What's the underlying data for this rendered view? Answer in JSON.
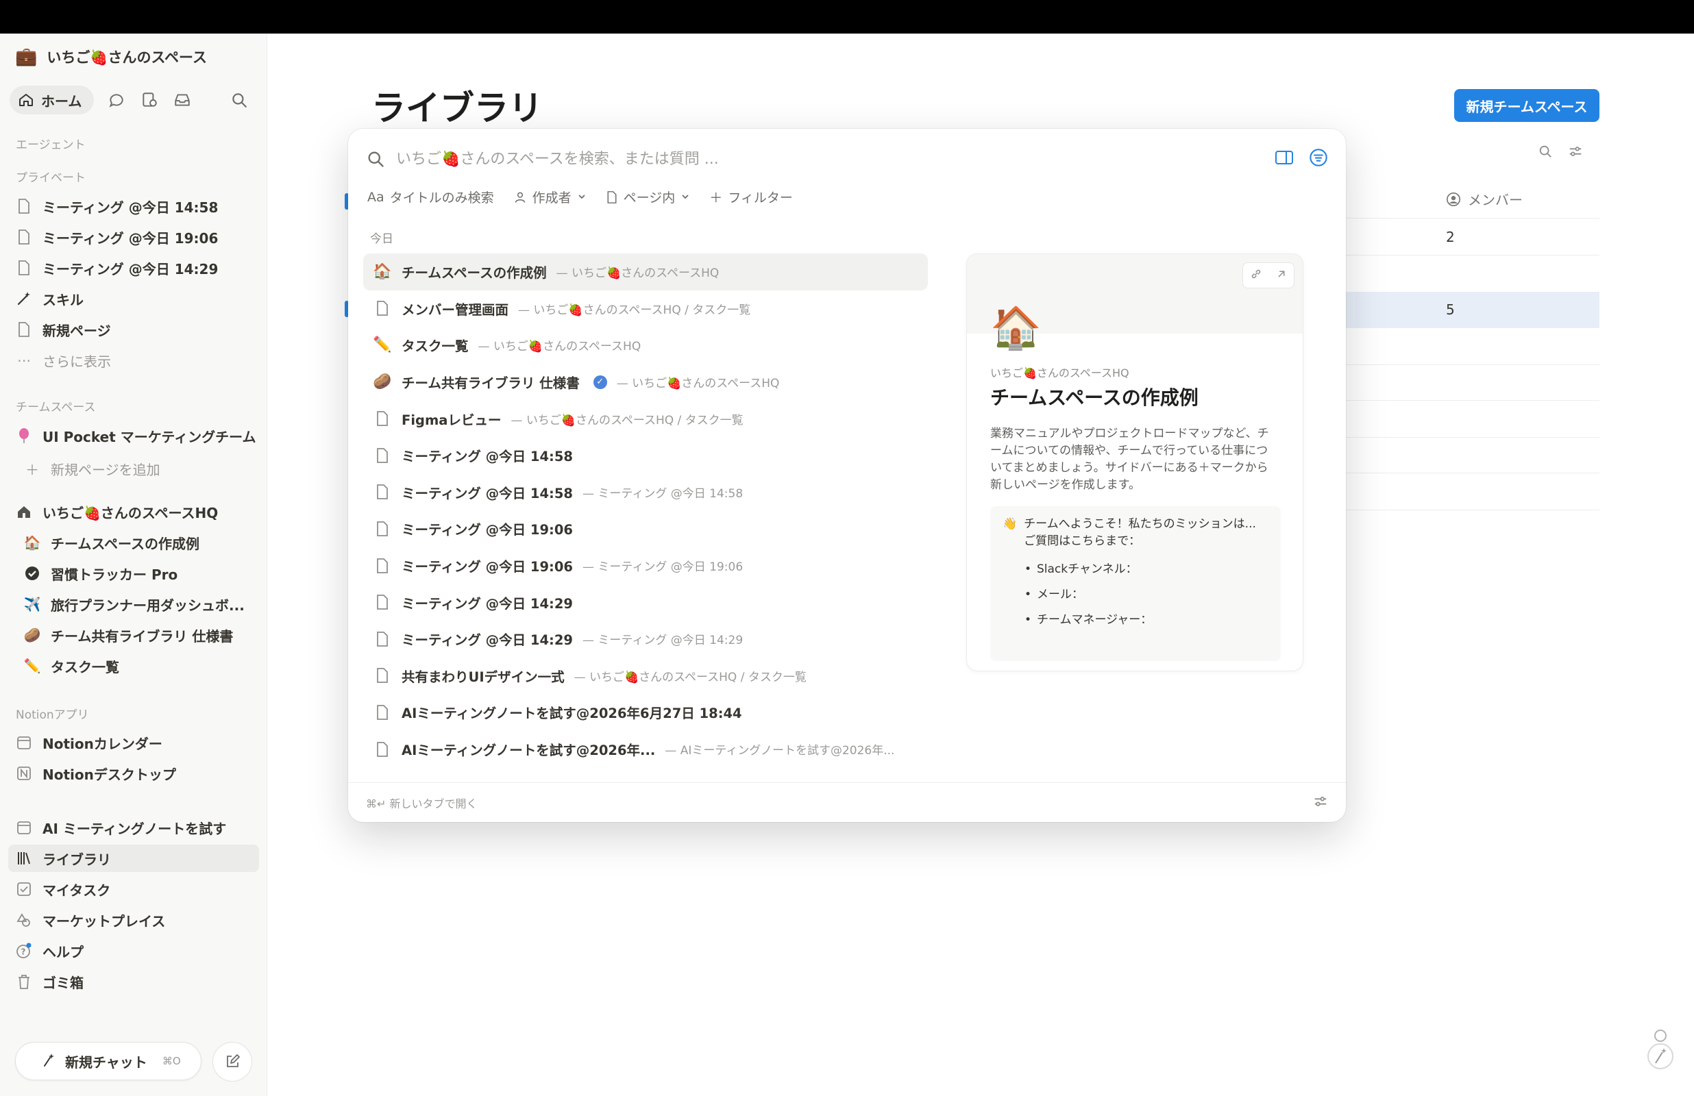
{
  "workspace": {
    "name": "いちご🍓さんのスペース"
  },
  "nav": {
    "home": "ホーム"
  },
  "sidebar": {
    "agent_label": "エージェント",
    "private_label": "プライベート",
    "private_items": [
      {
        "label": "ミーティング @今日 14:58"
      },
      {
        "label": "ミーティング @今日 19:06"
      },
      {
        "label": "ミーティング @今日 14:29"
      },
      {
        "label": "スキル"
      },
      {
        "label": "新規ページ"
      },
      {
        "label": "さらに表示"
      }
    ],
    "teamspace_label": "チームスペース",
    "teamspace_items": [
      {
        "label": "UI Pocket マーケティングチーム"
      },
      {
        "label": "新規ページを追加"
      }
    ],
    "hq_items": [
      {
        "label": "いちご🍓さんのスペースHQ"
      },
      {
        "label": "チームスペースの作成例"
      },
      {
        "label": "習慣トラッカー Pro"
      },
      {
        "label": "旅行プランナー用ダッシュボ..."
      },
      {
        "label": "チーム共有ライブラリ 仕様書"
      },
      {
        "label": "タスク一覧"
      }
    ],
    "notion_apps_label": "Notionアプリ",
    "notion_apps": [
      {
        "label": "Notionカレンダー"
      },
      {
        "label": "Notionデスクトップ"
      }
    ],
    "bottom_items": [
      {
        "label": "AI ミーティングノートを試す"
      },
      {
        "label": "ライブラリ"
      },
      {
        "label": "マイタスク"
      },
      {
        "label": "マーケットプレイス"
      },
      {
        "label": "ヘルプ"
      },
      {
        "label": "ゴミ箱"
      }
    ],
    "new_chat": "新規チャット",
    "new_chat_kbd": "⌘O"
  },
  "main": {
    "title": "ライブラリ",
    "new_teamspace": "新規チームスペース",
    "members_col": "メンバー",
    "rows": [
      "2",
      "5"
    ]
  },
  "search": {
    "placeholder": "いちご🍓さんのスペースを検索、または質問 ...",
    "filters": {
      "title_only": "タイトルのみ検索",
      "author": "作成者",
      "in_page": "ページ内",
      "filter": "フィルター"
    },
    "section": "今日",
    "results": [
      {
        "icon": "🏠",
        "title": "チームスペースの作成例",
        "path": "— いちご🍓さんのスペースHQ"
      },
      {
        "icon": "page",
        "title": "メンバー管理画面",
        "path": "— いちご🍓さんのスペースHQ / タスク一覧"
      },
      {
        "icon": "✏️",
        "title": "タスク一覧",
        "path": "— いちご🍓さんのスペースHQ"
      },
      {
        "icon": "🥔",
        "title": "チーム共有ライブラリ 仕様書",
        "path": "— いちご🍓さんのスペースHQ"
      },
      {
        "icon": "page",
        "title": "Figmaレビュー",
        "path": "— いちご🍓さんのスペースHQ / タスク一覧"
      },
      {
        "icon": "page",
        "title": "ミーティング @今日 14:58",
        "path": ""
      },
      {
        "icon": "page",
        "title": "ミーティング @今日 14:58",
        "path": "— ミーティング @今日 14:58"
      },
      {
        "icon": "page",
        "title": "ミーティング @今日 19:06",
        "path": ""
      },
      {
        "icon": "page",
        "title": "ミーティング @今日 19:06",
        "path": "— ミーティング @今日 19:06"
      },
      {
        "icon": "page",
        "title": "ミーティング @今日 14:29",
        "path": ""
      },
      {
        "icon": "page",
        "title": "ミーティング @今日 14:29",
        "path": "— ミーティング @今日 14:29"
      },
      {
        "icon": "page",
        "title": "共有まわりUIデザイン一式",
        "path": "— いちご🍓さんのスペースHQ / タスク一覧"
      },
      {
        "icon": "page",
        "title": "AIミーティングノートを試す@2026年6月27日 18:44",
        "path": ""
      },
      {
        "icon": "page",
        "title": "AIミーティングノートを試す@2026年...",
        "path": "— AIミーティングノートを試す@2026年..."
      }
    ],
    "footer_hint": "⌘↵ 新しいタブで開く"
  },
  "preview": {
    "emoji": "🏠",
    "breadcrumb": "いちご🍓さんのスペースHQ",
    "title": "チームスペースの作成例",
    "description": "業務マニュアルやプロジェクトロードマップなど、チームについての情報や、チームで行っている仕事についてまとめましょう。サイドバーにある＋マークから新しいページを作成します。",
    "callout_emoji": "👋",
    "callout_text": "チームへようこそ！私たちのミッションは...",
    "callout_sub": "ご質問はこちらまで：",
    "bullets": [
      "Slackチャンネル：",
      "メール：",
      "チームマネージャー："
    ]
  },
  "colors": {
    "accent": "#2383e2",
    "sidebar_bg": "#f8f8f7",
    "row_highlight": "#e7eef8"
  }
}
